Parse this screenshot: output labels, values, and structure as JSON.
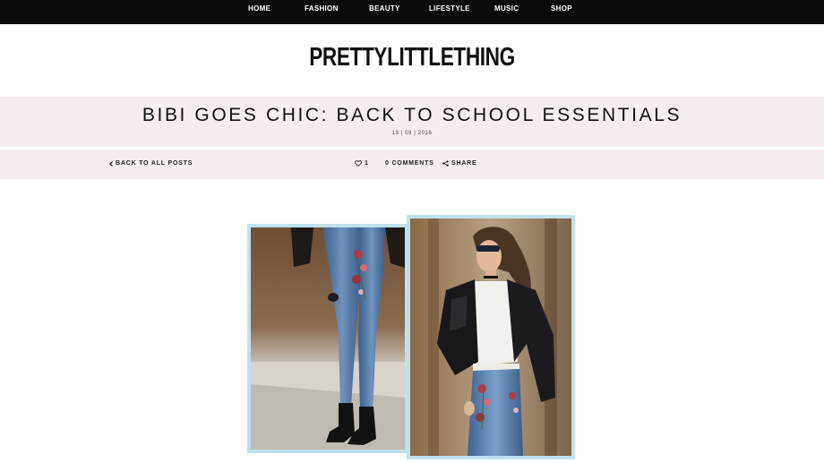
{
  "nav": {
    "items": [
      {
        "label": "HOME"
      },
      {
        "label": "FASHION"
      },
      {
        "label": "BEAUTY"
      },
      {
        "label": "LIFESTYLE"
      },
      {
        "label": "MUSIC"
      },
      {
        "label": "SHOP"
      }
    ]
  },
  "brand": {
    "logo_text": "PRETTYLITTLETHING"
  },
  "post": {
    "title": "BIBI GOES CHIC: BACK TO SCHOOL ESSENTIALS",
    "date": "13 | 09 | 2016",
    "back_label": "BACK TO ALL POSTS",
    "likes": "1",
    "comments_label": "0 COMMENTS",
    "share_label": "SHARE"
  },
  "icons": {
    "back": "chevron-left-icon",
    "like": "heart-icon",
    "share": "share-icon"
  },
  "colors": {
    "nav_bg": "#0b0b0b",
    "band_bg": "#f6edee",
    "photo_frame": "#bfe1ee"
  }
}
